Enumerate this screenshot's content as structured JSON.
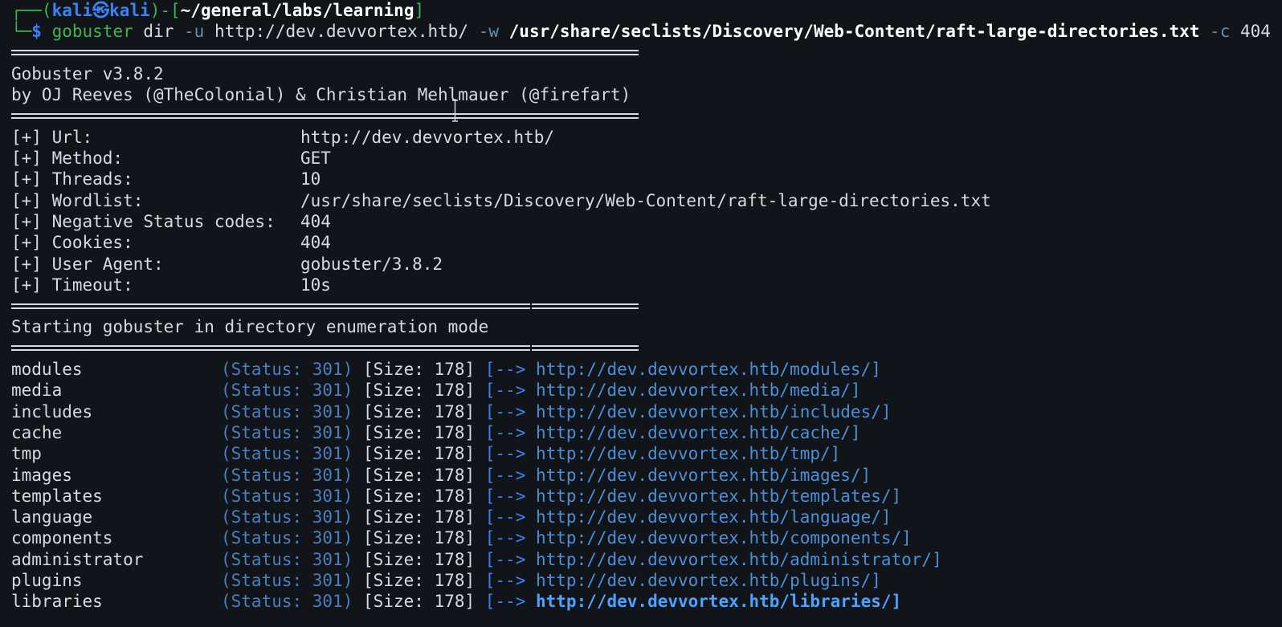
{
  "prompt": {
    "corner_top": "┌──(",
    "user": "kali",
    "at_icon": "㉿",
    "host": "kali",
    "mid": ")-[",
    "path": "~/general/labs/learning",
    "end": "]",
    "corner_bottom": "└─",
    "dollar": "$"
  },
  "command": {
    "binary": "gobuster",
    "mode": "dir",
    "url_flag": "-u",
    "url": "http://dev.devvortex.htb/",
    "wordlist_flag": "-w",
    "wordlist": "/usr/share/seclists/Discovery/Web-Content/raft-large-directories.txt",
    "code_flag": "-c",
    "code": "404"
  },
  "banner": {
    "version": "Gobuster v3.8.2",
    "authors": "by OJ Reeves (@TheColonial) & Christian Mehlmauer (@firefart)"
  },
  "config": [
    {
      "key": "[+] Url:",
      "value": "http://dev.devvortex.htb/"
    },
    {
      "key": "[+] Method:",
      "value": "GET"
    },
    {
      "key": "[+] Threads:",
      "value": "10"
    },
    {
      "key": "[+] Wordlist:",
      "value": "/usr/share/seclists/Discovery/Web-Content/raft-large-directories.txt"
    },
    {
      "key": "[+] Negative Status codes:",
      "value": "404"
    },
    {
      "key": "[+] Cookies:",
      "value": "404"
    },
    {
      "key": "[+] User Agent:",
      "value": "gobuster/3.8.2"
    },
    {
      "key": "[+] Timeout:",
      "value": "10s"
    }
  ],
  "start_message": "Starting gobuster in directory enumeration mode",
  "results": [
    {
      "path": "modules",
      "status": "(Status: 301)",
      "size": "[Size: 178]",
      "arrow": "[-->",
      "url": "http://dev.devvortex.htb/modules/]"
    },
    {
      "path": "media",
      "status": "(Status: 301)",
      "size": "[Size: 178]",
      "arrow": "[-->",
      "url": "http://dev.devvortex.htb/media/]"
    },
    {
      "path": "includes",
      "status": "(Status: 301)",
      "size": "[Size: 178]",
      "arrow": "[-->",
      "url": "http://dev.devvortex.htb/includes/]"
    },
    {
      "path": "cache",
      "status": "(Status: 301)",
      "size": "[Size: 178]",
      "arrow": "[-->",
      "url": "http://dev.devvortex.htb/cache/]"
    },
    {
      "path": "tmp",
      "status": "(Status: 301)",
      "size": "[Size: 178]",
      "arrow": "[-->",
      "url": "http://dev.devvortex.htb/tmp/]"
    },
    {
      "path": "images",
      "status": "(Status: 301)",
      "size": "[Size: 178]",
      "arrow": "[-->",
      "url": "http://dev.devvortex.htb/images/]"
    },
    {
      "path": "templates",
      "status": "(Status: 301)",
      "size": "[Size: 178]",
      "arrow": "[-->",
      "url": "http://dev.devvortex.htb/templates/]"
    },
    {
      "path": "language",
      "status": "(Status: 301)",
      "size": "[Size: 178]",
      "arrow": "[-->",
      "url": "http://dev.devvortex.htb/language/]"
    },
    {
      "path": "components",
      "status": "(Status: 301)",
      "size": "[Size: 178]",
      "arrow": "[-->",
      "url": "http://dev.devvortex.htb/components/]"
    },
    {
      "path": "administrator",
      "status": "(Status: 301)",
      "size": "[Size: 178]",
      "arrow": "[-->",
      "url": "http://dev.devvortex.htb/administrator/]"
    },
    {
      "path": "plugins",
      "status": "(Status: 301)",
      "size": "[Size: 178]",
      "arrow": "[-->",
      "url": "http://dev.devvortex.htb/plugins/]"
    },
    {
      "path": "libraries",
      "status": "(Status: 301)",
      "size": "[Size: 178]",
      "arrow": "[-->",
      "url": "http://dev.devvortex.htb/libraries/]"
    }
  ],
  "colors": {
    "background": "#111418",
    "text": "#d7dbe0",
    "prompt_green": "#3fb34f",
    "prompt_blue": "#3b82f6",
    "status": "#4a7fc0",
    "url": "#4a90d9"
  },
  "icons": {
    "mouse_cursor": "ibeam-cursor-icon"
  }
}
